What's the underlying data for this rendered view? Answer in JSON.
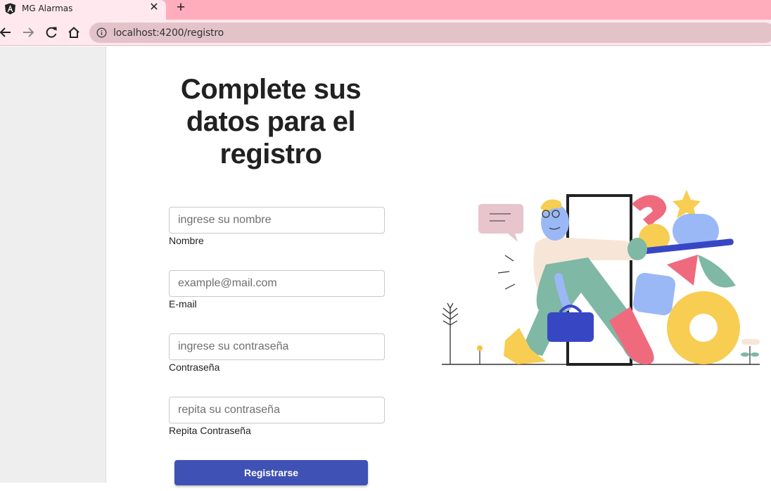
{
  "browser": {
    "tab_title": "MG Alarmas",
    "tab_close": "✕",
    "new_tab": "+",
    "url": "localhost:4200/registro"
  },
  "page": {
    "title": "Complete sus datos para el registro",
    "illustration": "person-walking-through-door-illustration"
  },
  "form": {
    "fields": [
      {
        "placeholder": "ingrese su nombre",
        "label": "Nombre",
        "value": ""
      },
      {
        "placeholder": "example@mail.com",
        "label": "E-mail",
        "value": ""
      },
      {
        "placeholder": "ingrese su contraseña",
        "label": "Contraseña",
        "value": ""
      },
      {
        "placeholder": "repita su contraseña",
        "label": "Repita Contraseña",
        "value": ""
      }
    ],
    "submit_label": "Registrarse"
  },
  "colors": {
    "tabstrip": "#ffadbd",
    "toolbar": "#ffe9ee",
    "primary_button": "#3f51b5",
    "sidebar": "#eeeeee"
  }
}
